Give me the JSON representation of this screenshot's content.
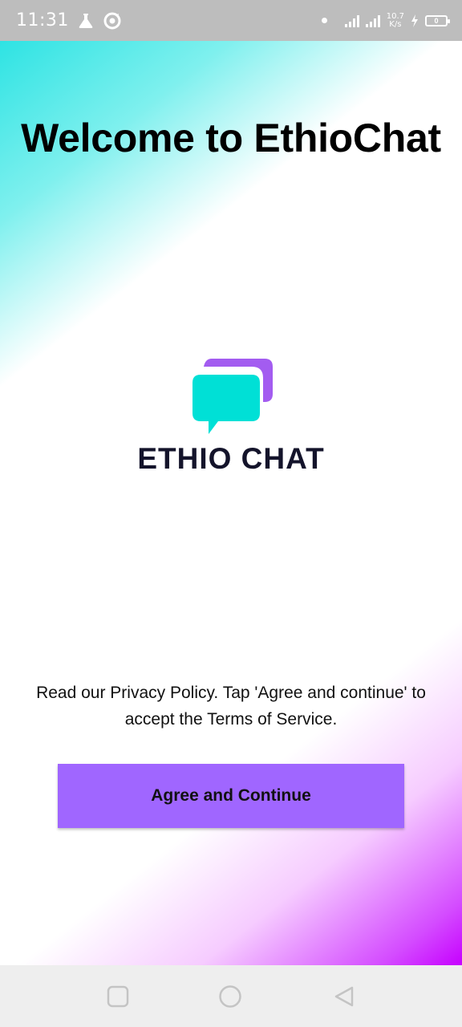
{
  "status_bar": {
    "time": "11:31",
    "network_speed_value": "10.7",
    "network_speed_unit": "K/s",
    "battery_level": "0"
  },
  "title": "Welcome to EthioChat",
  "logo": {
    "text": "ETHIO CHAT",
    "colors": {
      "front_bubble": "#00e0d6",
      "back_bubble": "#a35cf0",
      "text": "#14142b"
    }
  },
  "policy_text": "Read our Privacy Policy. Tap 'Agree and continue' to accept the Terms of Service.",
  "agree_button": {
    "label": "Agree and Continue",
    "color": "#a066ff"
  },
  "navigation": {
    "recents_icon": "square-icon",
    "home_icon": "circle-icon",
    "back_icon": "triangle-back-icon"
  }
}
